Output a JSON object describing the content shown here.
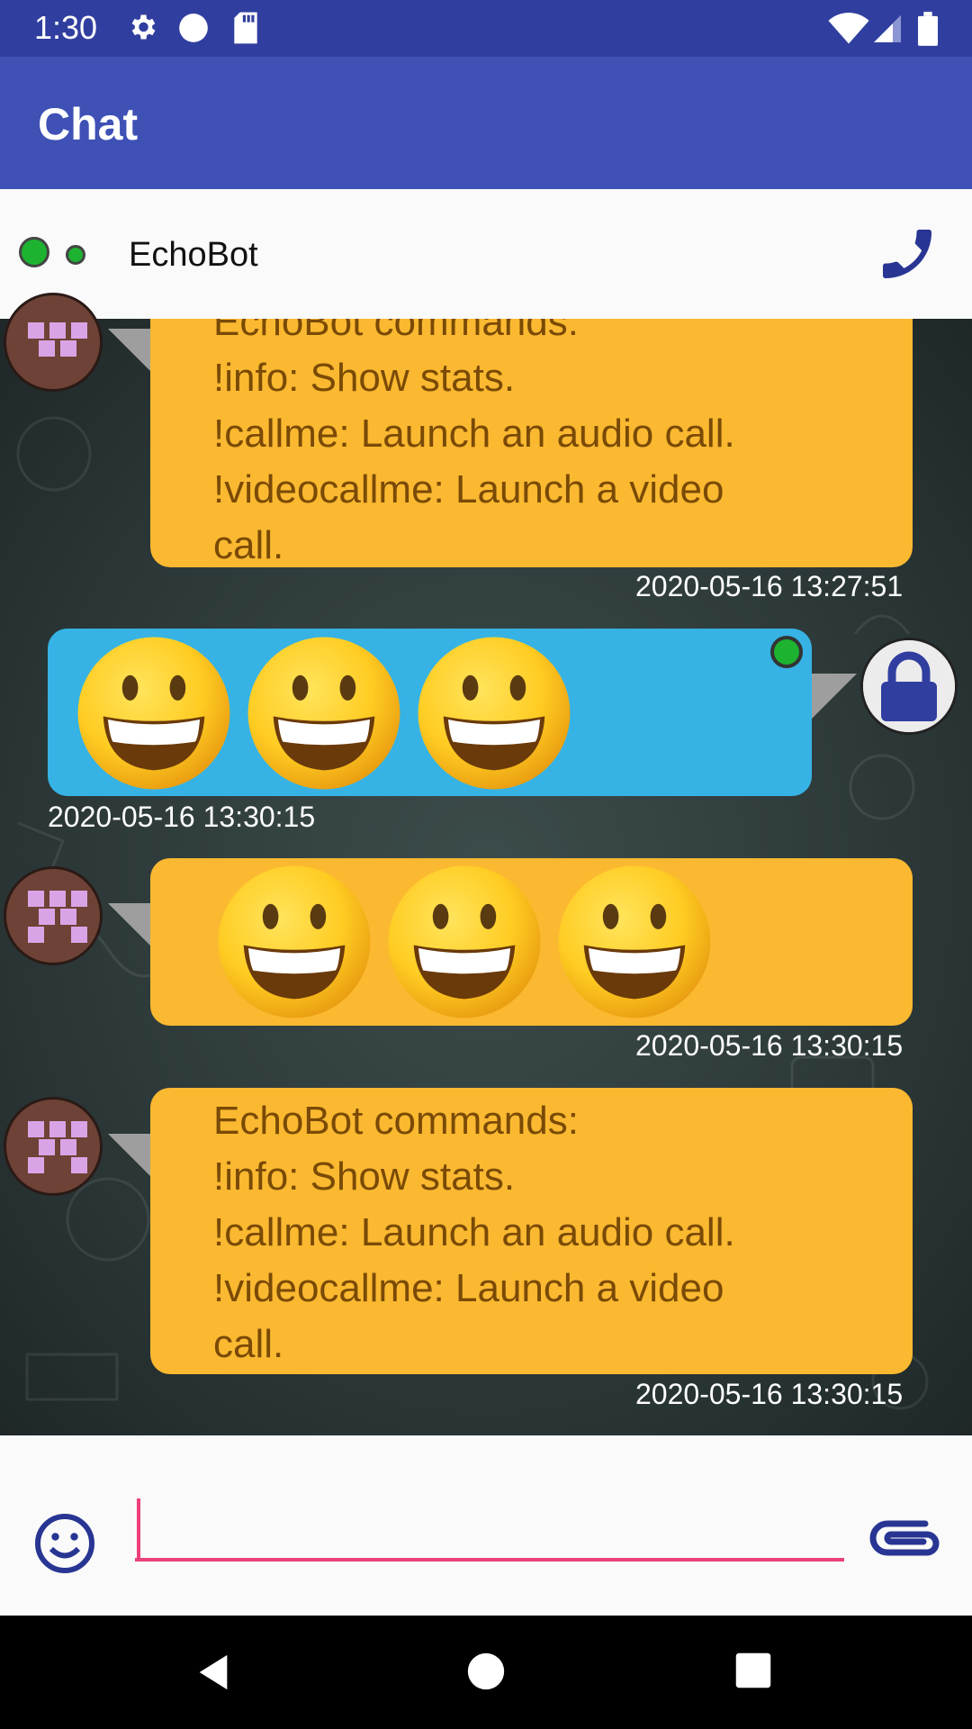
{
  "status_bar": {
    "time": "1:30",
    "icons": [
      "gear-icon",
      "circle-icon",
      "sd-card-icon",
      "wifi-icon",
      "signal-icon",
      "battery-icon"
    ]
  },
  "app_bar": {
    "title": "Chat"
  },
  "contact": {
    "name": "EchoBot",
    "call_icon": "phone-icon",
    "status_color": "#1db330"
  },
  "messages": [
    {
      "sender": "bot",
      "text": "EchoBot commands:\n!info: Show stats.\n!callme: Launch an audio call.\n!videocallme: Launch a video\ncall.",
      "timestamp": "2020-05-16 13:27:51"
    },
    {
      "sender": "me",
      "emoji_count": 3,
      "emoji": "grinning-face",
      "timestamp": "2020-05-16 13:30:15"
    },
    {
      "sender": "bot",
      "emoji_count": 3,
      "emoji": "grinning-face",
      "timestamp": "2020-05-16 13:30:15"
    },
    {
      "sender": "bot",
      "text": "EchoBot commands:\n!info: Show stats.\n!callme: Launch an audio call.\n!videocallme: Launch a video\ncall.",
      "timestamp": "2020-05-16 13:30:15"
    }
  ],
  "composer": {
    "value": "",
    "placeholder": "",
    "emoji_icon": "smiley-icon",
    "attach_icon": "paperclip-icon"
  },
  "colors": {
    "primary": "#3f51b5",
    "primary_dark": "#303f9f",
    "bot_bubble": "#fbb931",
    "my_bubble": "#36b3e4",
    "accent": "#ec407a"
  },
  "nav_bar": {
    "icons": [
      "back-icon",
      "home-icon",
      "recents-icon"
    ]
  }
}
